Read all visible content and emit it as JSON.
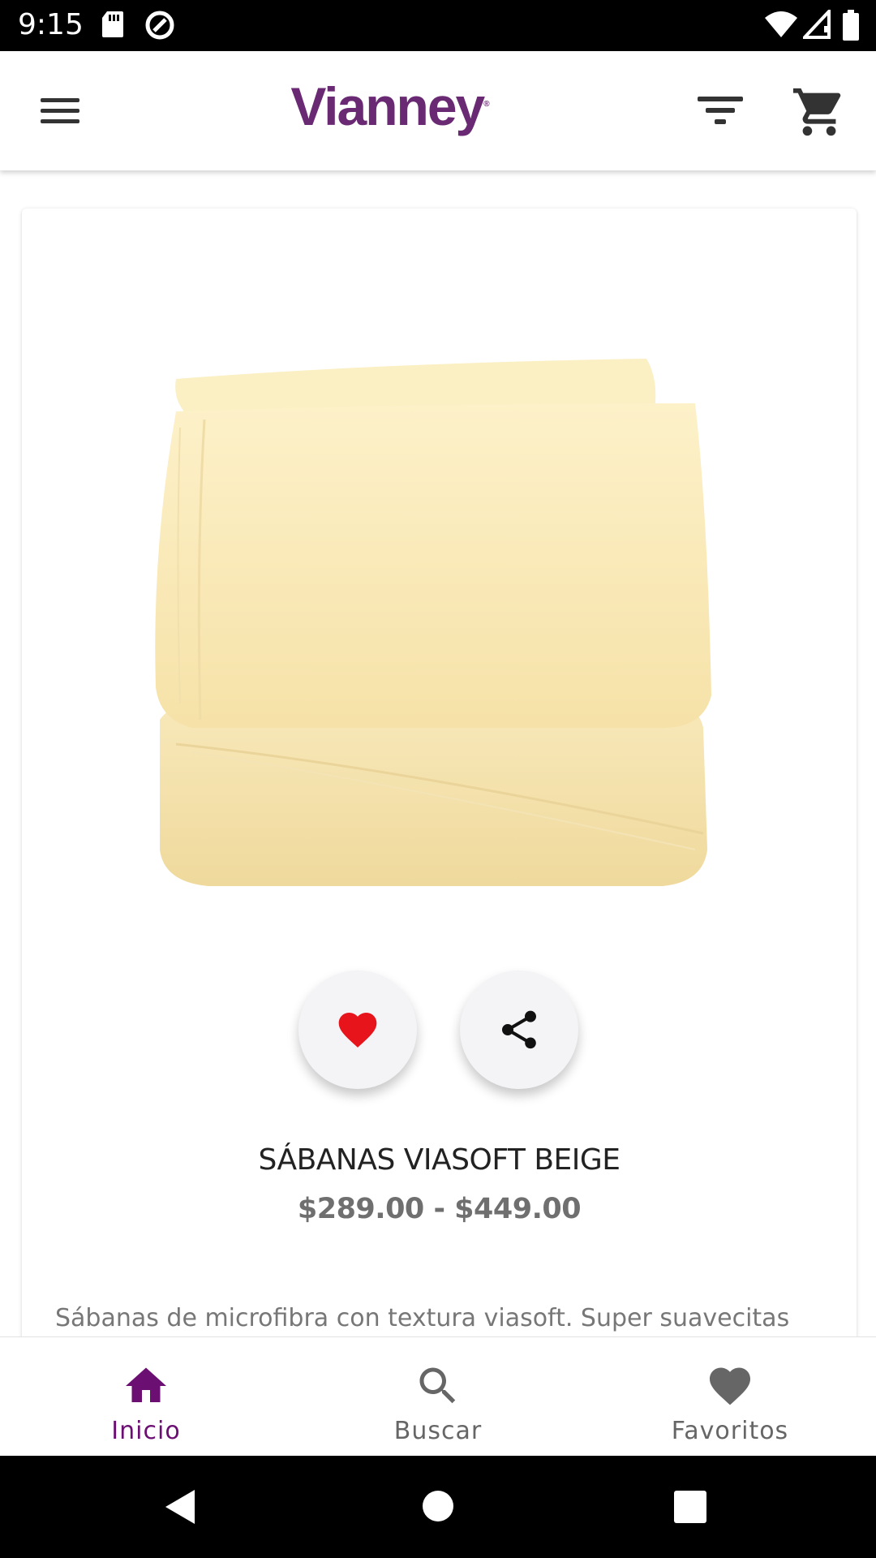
{
  "status_bar": {
    "time": "9:15"
  },
  "app_bar": {
    "logo_text": "Vianney",
    "logo_mark": "®",
    "icons": [
      "menu-icon",
      "filter-icon",
      "cart-icon"
    ]
  },
  "product": {
    "name": "SÁBANAS VIASOFT BEIGE",
    "price": "$289.00 - $449.00",
    "description": "Sábanas de microfibra con textura viasoft. Super suavecitas",
    "favorite": true
  },
  "bottom_nav": {
    "items": [
      {
        "label": "Inicio",
        "icon": "home-icon",
        "active": true
      },
      {
        "label": "Buscar",
        "icon": "search-icon",
        "active": false
      },
      {
        "label": "Favoritos",
        "icon": "heart-icon",
        "active": false
      }
    ]
  },
  "colors": {
    "brand": "#6a2a73",
    "active_nav": "#6b0f72",
    "favorite": "#e8141b",
    "inactive_nav": "#666666"
  }
}
